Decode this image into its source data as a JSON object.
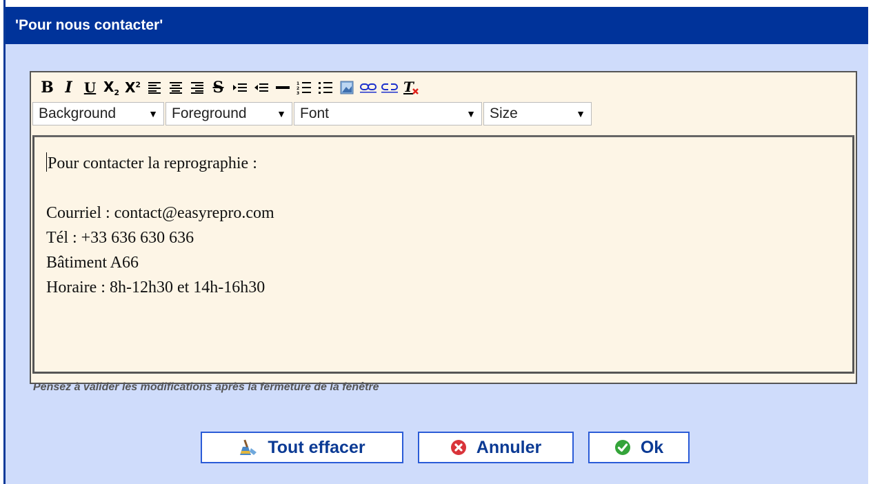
{
  "dialog": {
    "title": "'Pour nous contacter'"
  },
  "toolbar": {
    "buttons": [
      {
        "name": "bold",
        "icon": "bold-icon"
      },
      {
        "name": "italic",
        "icon": "italic-icon"
      },
      {
        "name": "underline",
        "icon": "underline-icon"
      },
      {
        "name": "subscript",
        "icon": "subscript-icon"
      },
      {
        "name": "superscript",
        "icon": "superscript-icon"
      },
      {
        "name": "align-left",
        "icon": "align-left-icon"
      },
      {
        "name": "align-center",
        "icon": "align-center-icon"
      },
      {
        "name": "align-right",
        "icon": "align-right-icon"
      },
      {
        "name": "strikethrough",
        "icon": "strikethrough-icon"
      },
      {
        "name": "indent",
        "icon": "indent-icon"
      },
      {
        "name": "outdent",
        "icon": "outdent-icon"
      },
      {
        "name": "horizontal-rule",
        "icon": "horizontal-rule-icon"
      },
      {
        "name": "ordered-list",
        "icon": "ordered-list-icon"
      },
      {
        "name": "unordered-list",
        "icon": "unordered-list-icon"
      },
      {
        "name": "insert-image",
        "icon": "image-icon"
      },
      {
        "name": "insert-link",
        "icon": "link-icon"
      },
      {
        "name": "remove-link",
        "icon": "unlink-icon"
      },
      {
        "name": "remove-format",
        "icon": "remove-format-icon"
      }
    ],
    "selects": {
      "background": "Background",
      "foreground": "Foreground",
      "font": "Font",
      "size": "Size"
    }
  },
  "content": {
    "lines": [
      "Pour contacter la reprographie :",
      "",
      "Courriel : contact@easyrepro.com",
      "Tél : +33 636 630 636",
      "Bâtiment A66",
      "Horaire : 8h-12h30 et 14h-16h30"
    ]
  },
  "hint": "Pensez à valider les modifications après la fermeture de la fenêtre",
  "actions": {
    "clear_label": "Tout effacer",
    "cancel_label": "Annuler",
    "ok_label": "Ok"
  },
  "colors": {
    "title_bar": "#00339a",
    "dialog_bg": "#cfdcfb",
    "editor_bg": "#fdf5e6",
    "button_text": "#0b3a94",
    "button_border": "#2a5bd7",
    "cancel_icon": "#d9343a",
    "ok_icon": "#34a43a"
  }
}
